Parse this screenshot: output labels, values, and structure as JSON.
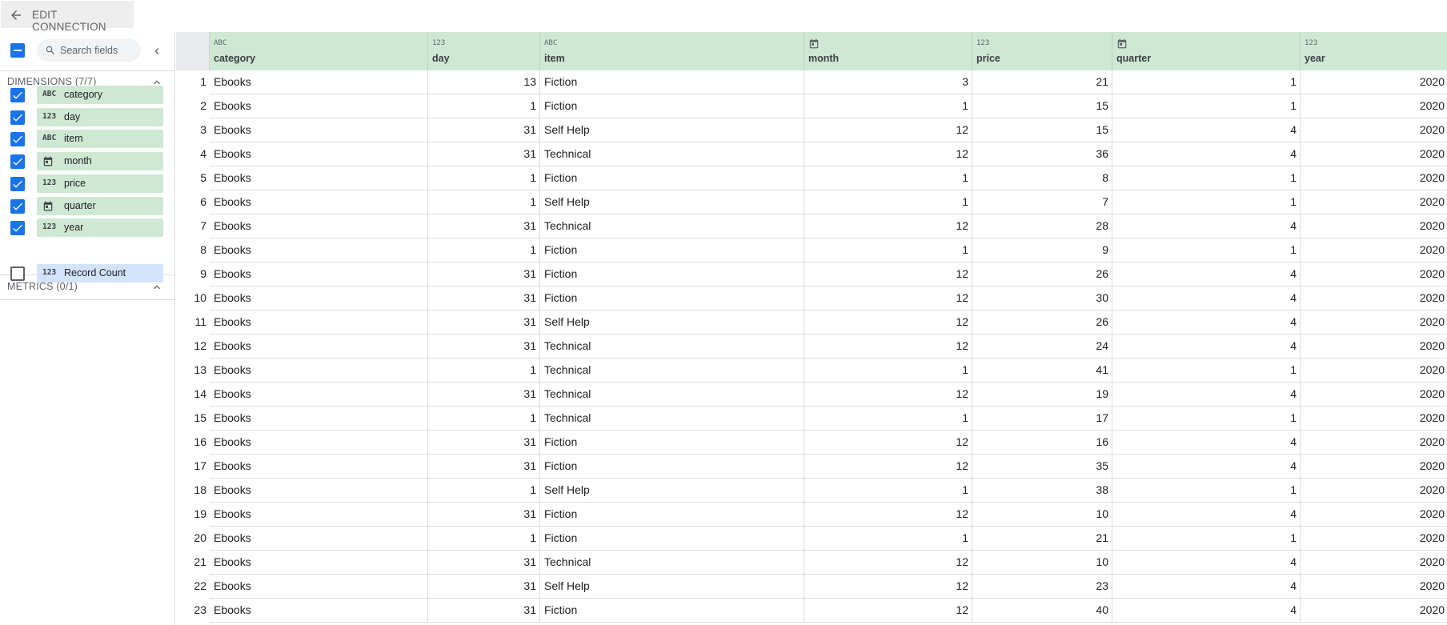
{
  "header": {
    "edit_label": "EDIT CONNECTION"
  },
  "sidebar": {
    "search_placeholder": "Search fields",
    "dimensions_title": "DIMENSIONS (7/7)",
    "metrics_title": "METRICS (0/1)",
    "dimensions": [
      {
        "name": "category",
        "type": "ABC",
        "icon": "text-type-icon",
        "checked": true
      },
      {
        "name": "day",
        "type": "123",
        "icon": "number-type-icon",
        "checked": true
      },
      {
        "name": "item",
        "type": "ABC",
        "icon": "text-type-icon",
        "checked": true
      },
      {
        "name": "month",
        "type": "date",
        "icon": "calendar-icon",
        "checked": true
      },
      {
        "name": "price",
        "type": "123",
        "icon": "number-type-icon",
        "checked": true
      },
      {
        "name": "quarter",
        "type": "date",
        "icon": "calendar-icon",
        "checked": true
      },
      {
        "name": "year",
        "type": "123",
        "icon": "number-type-icon",
        "checked": true
      }
    ],
    "metrics": [
      {
        "name": "Record Count",
        "type": "123",
        "icon": "number-type-icon",
        "checked": false
      }
    ]
  },
  "table": {
    "columns": [
      {
        "name": "category",
        "type": "ABC",
        "align": "l"
      },
      {
        "name": "day",
        "type": "123",
        "align": "r"
      },
      {
        "name": "item",
        "type": "ABC",
        "align": "l"
      },
      {
        "name": "month",
        "type": "date",
        "align": "r"
      },
      {
        "name": "price",
        "type": "123",
        "align": "r"
      },
      {
        "name": "quarter",
        "type": "date",
        "align": "r"
      },
      {
        "name": "year",
        "type": "123",
        "align": "r"
      }
    ],
    "rows": [
      [
        "1",
        "Ebooks",
        "13",
        "Fiction",
        "3",
        "21",
        "1",
        "2020"
      ],
      [
        "2",
        "Ebooks",
        "1",
        "Fiction",
        "1",
        "15",
        "1",
        "2020"
      ],
      [
        "3",
        "Ebooks",
        "31",
        "Self Help",
        "12",
        "15",
        "4",
        "2020"
      ],
      [
        "4",
        "Ebooks",
        "31",
        "Technical",
        "12",
        "36",
        "4",
        "2020"
      ],
      [
        "5",
        "Ebooks",
        "1",
        "Fiction",
        "1",
        "8",
        "1",
        "2020"
      ],
      [
        "6",
        "Ebooks",
        "1",
        "Self Help",
        "1",
        "7",
        "1",
        "2020"
      ],
      [
        "7",
        "Ebooks",
        "31",
        "Technical",
        "12",
        "28",
        "4",
        "2020"
      ],
      [
        "8",
        "Ebooks",
        "1",
        "Fiction",
        "1",
        "9",
        "1",
        "2020"
      ],
      [
        "9",
        "Ebooks",
        "31",
        "Fiction",
        "12",
        "26",
        "4",
        "2020"
      ],
      [
        "10",
        "Ebooks",
        "31",
        "Fiction",
        "12",
        "30",
        "4",
        "2020"
      ],
      [
        "11",
        "Ebooks",
        "31",
        "Self Help",
        "12",
        "26",
        "4",
        "2020"
      ],
      [
        "12",
        "Ebooks",
        "31",
        "Technical",
        "12",
        "24",
        "4",
        "2020"
      ],
      [
        "13",
        "Ebooks",
        "1",
        "Technical",
        "1",
        "41",
        "1",
        "2020"
      ],
      [
        "14",
        "Ebooks",
        "31",
        "Technical",
        "12",
        "19",
        "4",
        "2020"
      ],
      [
        "15",
        "Ebooks",
        "1",
        "Technical",
        "1",
        "17",
        "1",
        "2020"
      ],
      [
        "16",
        "Ebooks",
        "31",
        "Fiction",
        "12",
        "16",
        "4",
        "2020"
      ],
      [
        "17",
        "Ebooks",
        "31",
        "Fiction",
        "12",
        "35",
        "4",
        "2020"
      ],
      [
        "18",
        "Ebooks",
        "1",
        "Self Help",
        "1",
        "38",
        "1",
        "2020"
      ],
      [
        "19",
        "Ebooks",
        "31",
        "Fiction",
        "12",
        "10",
        "4",
        "2020"
      ],
      [
        "20",
        "Ebooks",
        "1",
        "Fiction",
        "1",
        "21",
        "1",
        "2020"
      ],
      [
        "21",
        "Ebooks",
        "31",
        "Technical",
        "12",
        "10",
        "4",
        "2020"
      ],
      [
        "22",
        "Ebooks",
        "31",
        "Self Help",
        "12",
        "23",
        "4",
        "2020"
      ],
      [
        "23",
        "Ebooks",
        "31",
        "Fiction",
        "12",
        "40",
        "4",
        "2020"
      ]
    ]
  },
  "colors": {
    "accent": "#1a73e8",
    "dimension_chip": "#cfe8d4",
    "metric_chip": "#d2e3fc",
    "header_bg": "#cfe8d4"
  }
}
